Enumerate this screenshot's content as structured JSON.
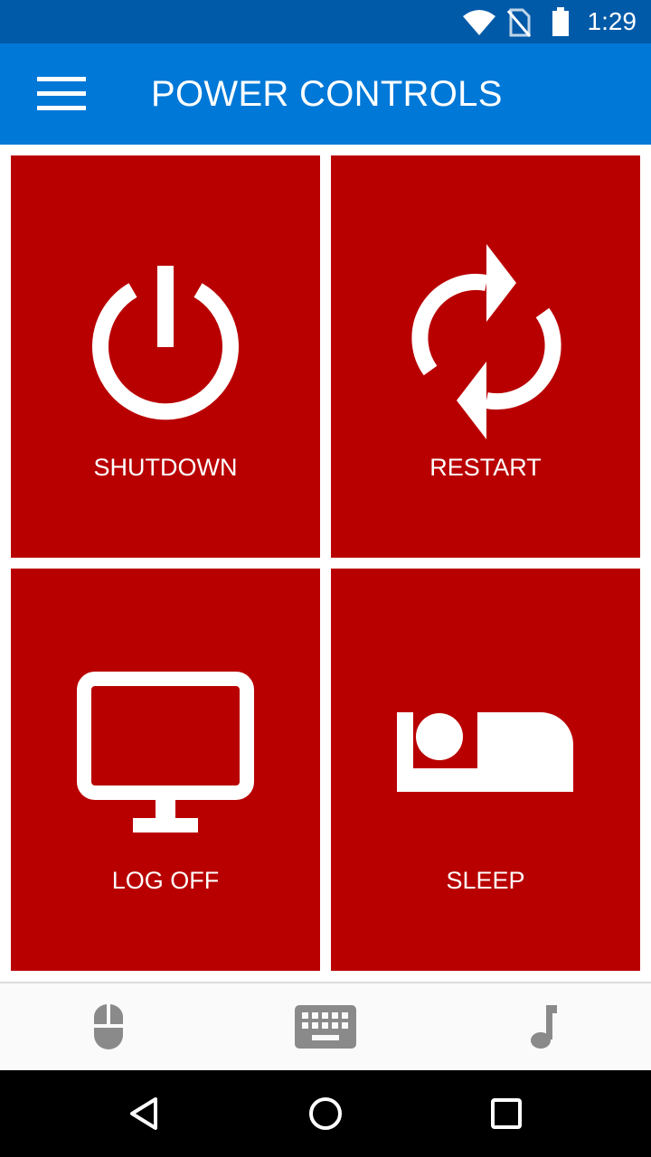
{
  "status_bar": {
    "time": "1:29",
    "icons": [
      "wifi-icon",
      "no-sim-icon",
      "battery-icon"
    ]
  },
  "app_bar": {
    "title": "POWER CONTROLS",
    "menu_icon": "hamburger-menu-icon"
  },
  "tiles": [
    {
      "label": "SHUTDOWN",
      "icon": "power-icon"
    },
    {
      "label": "RESTART",
      "icon": "refresh-icon"
    },
    {
      "label": "LOG OFF",
      "icon": "monitor-icon"
    },
    {
      "label": "SLEEP",
      "icon": "bed-icon"
    }
  ],
  "bottom_nav": [
    {
      "icon": "mouse-icon"
    },
    {
      "icon": "keyboard-icon"
    },
    {
      "icon": "music-note-icon"
    }
  ],
  "system_nav": [
    "back-icon",
    "home-icon",
    "recents-icon"
  ],
  "colors": {
    "status_bar": "#005aa8",
    "app_bar": "#0078d7",
    "tile": "#b90000",
    "bottom_nav_icon": "#8a8a8a"
  }
}
